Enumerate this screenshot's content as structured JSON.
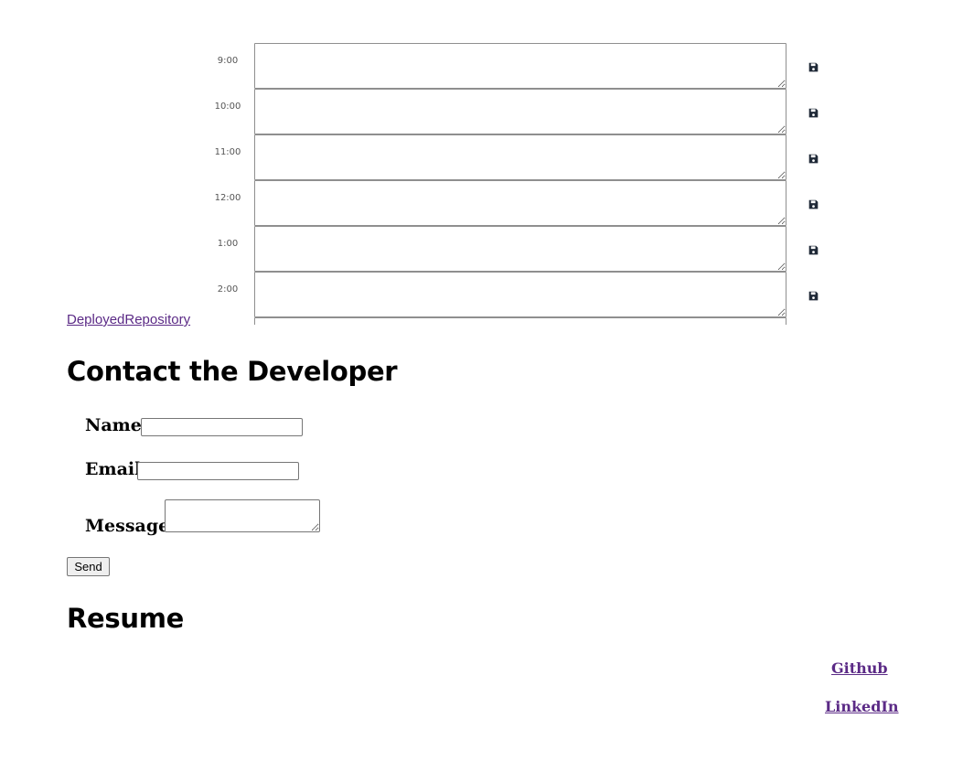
{
  "scheduler": {
    "rows": [
      {
        "hour": "9:00",
        "text": ""
      },
      {
        "hour": "10:00",
        "text": ""
      },
      {
        "hour": "11:00",
        "text": ""
      },
      {
        "hour": "12:00",
        "text": ""
      },
      {
        "hour": "1:00",
        "text": ""
      },
      {
        "hour": "2:00",
        "text": ""
      },
      {
        "hour": "",
        "text": ""
      }
    ],
    "save_icon": "floppy-disk-icon"
  },
  "repo_link": "DeployedRepository",
  "contact": {
    "title": "Contact the Developer",
    "name_label": "Name:",
    "name_value": "",
    "email_label": "Email:",
    "email_value": "",
    "message_label": "Message:",
    "message_value": "",
    "send_label": "Send"
  },
  "resume": {
    "title": "Resume"
  },
  "links": {
    "github": "Github",
    "linkedin": "LinkedIn"
  },
  "colors": {
    "link": "#5b2a86",
    "save_icon": "#1f2937"
  }
}
